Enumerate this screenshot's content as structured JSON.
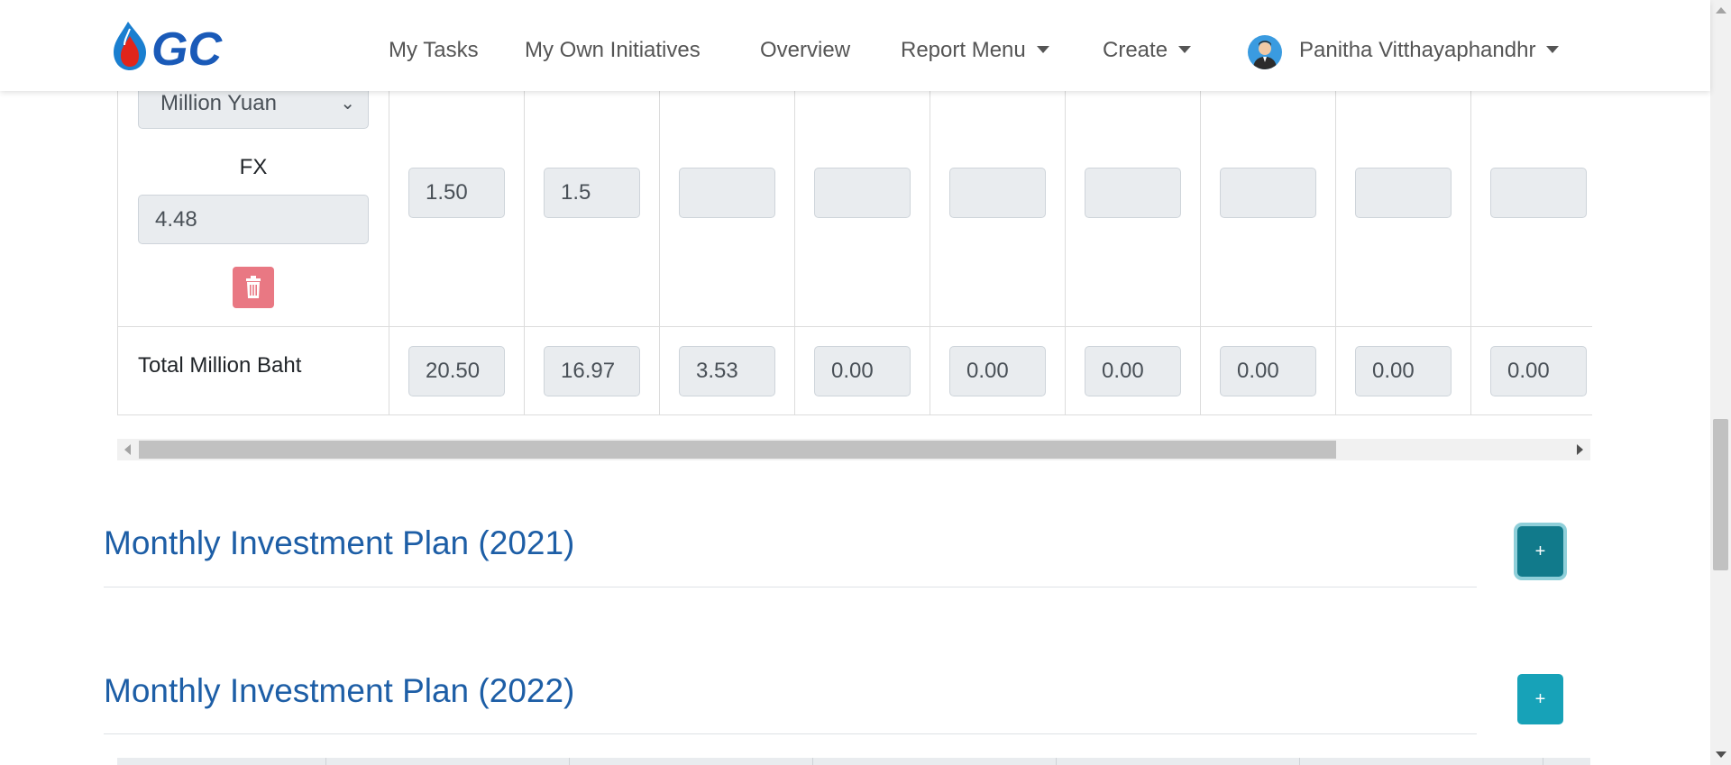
{
  "navbar": {
    "logo_text": "GC",
    "items": [
      {
        "label": "My Tasks"
      },
      {
        "label": "My Own Initiatives"
      },
      {
        "label": "Overview"
      },
      {
        "label": "Report Menu"
      },
      {
        "label": "Create"
      }
    ],
    "user_name": "Panitha Vitthayaphandhr"
  },
  "currency_row": {
    "currency_select": "Million Yuan",
    "fx_label": "FX",
    "fx_value": "4.48",
    "values": [
      "1.50",
      "1.5",
      "",
      "",
      "",
      "",
      "",
      "",
      ""
    ]
  },
  "total_row": {
    "label": "Total Million Baht",
    "values": [
      "20.50",
      "16.97",
      "3.53",
      "0.00",
      "0.00",
      "0.00",
      "0.00",
      "0.00",
      "0.00"
    ]
  },
  "sections": [
    {
      "title": "Monthly Investment Plan (2021)",
      "button": "+"
    },
    {
      "title": "Monthly Investment Plan (2022)",
      "button": "+"
    }
  ],
  "colors": {
    "title": "#1d5ea6",
    "button_active": "#117a8b",
    "button": "#17a2b8",
    "delete_button": "#e97883"
  },
  "icons": [
    "logo-flame-icon",
    "user-avatar-icon",
    "chevron-down-icon",
    "trash-icon",
    "scroll-left-icon",
    "scroll-right-icon"
  ]
}
